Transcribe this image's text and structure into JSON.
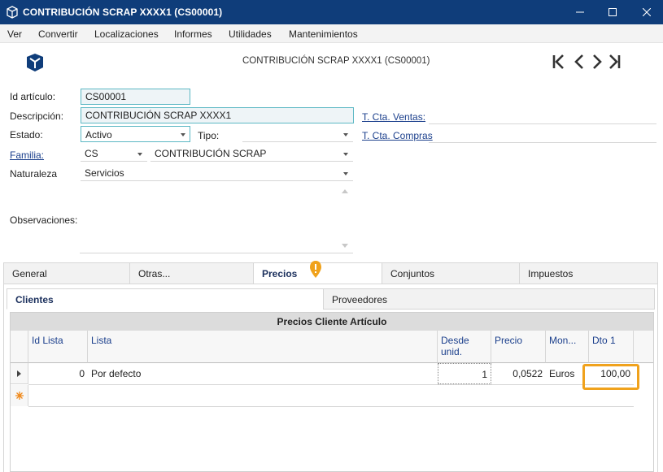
{
  "window": {
    "title": "CONTRIBUCIÓN SCRAP XXXX1 (CS00001)"
  },
  "menu": {
    "items": [
      "Ver",
      "Convertir",
      "Localizaciones",
      "Informes",
      "Utilidades",
      "Mantenimientos"
    ]
  },
  "header": {
    "title": "CONTRIBUCIÓN SCRAP XXXX1 (CS00001)"
  },
  "form": {
    "id_label": "Id artículo:",
    "id_value": "CS00001",
    "desc_label": "Descripción:",
    "desc_value": "CONTRIBUCIÓN SCRAP XXXX1",
    "estado_label": "Estado:",
    "estado_value": "Activo",
    "tipo_label": "Tipo:",
    "tipo_value": "",
    "familia_label": "Familia:",
    "familia_code": "CS",
    "familia_name": "CONTRIBUCIÓN SCRAP",
    "naturaleza_label": "Naturaleza",
    "naturaleza_value": "Servicios",
    "observaciones_label": "Observaciones:",
    "cta_ventas_label": "T. Cta. Ventas:",
    "cta_compras_label": "T. Cta. Compras"
  },
  "tabs": [
    "General",
    "Otras...",
    "Precios",
    "Conjuntos",
    "Impuestos"
  ],
  "subtabs": [
    "Clientes",
    "Proveedores"
  ],
  "grid": {
    "caption": "Precios Cliente Artículo",
    "columns": [
      "Id Lista",
      "Lista",
      "Desde unid.",
      "Precio",
      "Mon...",
      "Dto 1"
    ],
    "rows": [
      {
        "id": "0",
        "lista": "Por defecto",
        "desde": "1",
        "precio": "0,0522",
        "moneda": "Euros",
        "dto": "100,00"
      }
    ]
  },
  "colors": {
    "titlebar": "#0f3d7a",
    "highlight": "#f0a21c",
    "warning": "#f0a21c"
  }
}
